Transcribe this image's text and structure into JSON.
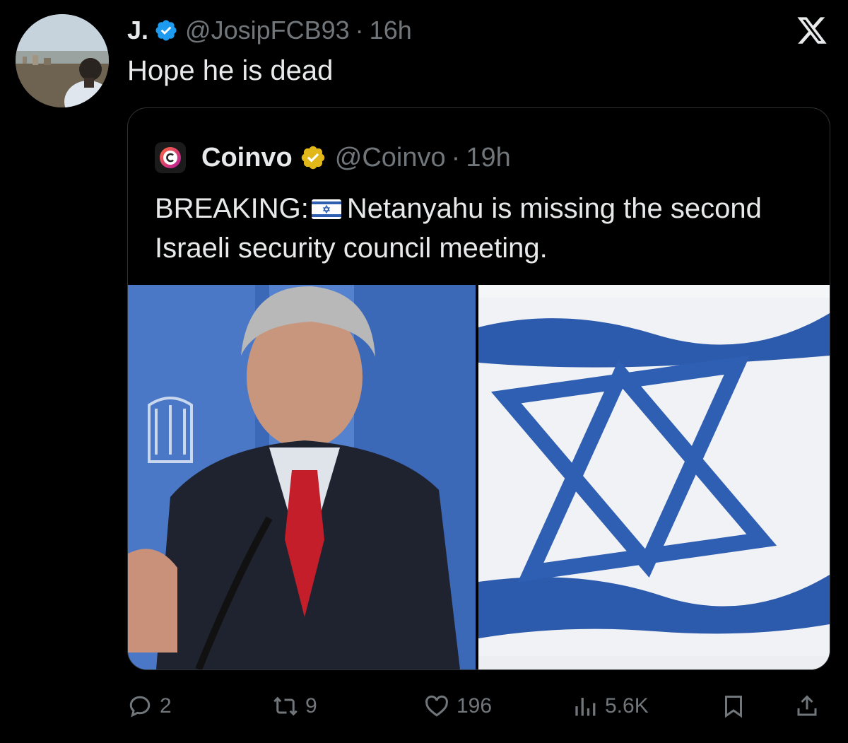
{
  "tweet": {
    "author_name": "J.",
    "handle": "@JosipFCB93",
    "separator": "·",
    "time": "16h",
    "text": "Hope he is dead"
  },
  "quote": {
    "author_name": "Coinvo",
    "handle": "@Coinvo",
    "separator": "·",
    "time": "19h",
    "text_before_flag": "BREAKING:",
    "text_after_flag": "Netanyahu is missing the second Israeli security council meeting."
  },
  "media": {
    "left_image_icon": "person-at-podium-image",
    "right_image_icon": "israeli-flag-image"
  },
  "actions": {
    "replies": "2",
    "reposts": "9",
    "likes": "196",
    "views": "5.6K"
  },
  "colors": {
    "background": "#000000",
    "text_primary": "#e7e9ea",
    "text_secondary": "#71767b",
    "verified_blue": "#1d9bf0",
    "verified_gold": "#e2b719",
    "border": "#2f3336"
  },
  "icons": [
    "verified-badge-icon",
    "x-logo-icon",
    "coinvo-logo-icon",
    "gold-verified-badge-icon",
    "israel-flag-icon",
    "reply-icon",
    "repost-icon",
    "like-icon",
    "views-icon",
    "bookmark-icon",
    "share-icon"
  ]
}
